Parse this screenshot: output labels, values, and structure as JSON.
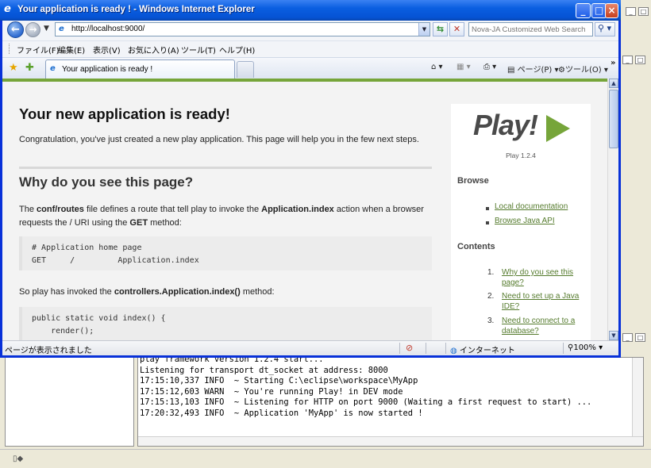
{
  "window": {
    "title": "Your application is ready ! - Windows Internet Explorer",
    "ie_icon": "e"
  },
  "address": {
    "url": "http://localhost:9000/",
    "search_placeholder": "Nova-JA Customized Web Search"
  },
  "menu": [
    "ファイル(F)",
    "編集(E)",
    "表示(V)",
    "お気に入り(A)",
    "ツール(T)",
    "ヘルプ(H)"
  ],
  "tab": {
    "label": "Your application is ready !"
  },
  "toolbar": {
    "page_label": "ページ(P)",
    "tools_label": "ツール(O)",
    "chevron": "»"
  },
  "page": {
    "h1": "Your new application is ready!",
    "intro": "Congratulation, you've just created a new play application. This page will help you in the few next steps.",
    "h2": "Why do you see this page?",
    "p1": {
      "t1": "The ",
      "b1": "conf/routes",
      "t2": " file defines a route that tell play to invoke the ",
      "b2": "Application.index",
      "t3": " action when a browser requests the / URI using the ",
      "b3": "GET",
      "t4": " method:"
    },
    "code1": "# Application home page\nGET     /         Application.index",
    "p2": {
      "t1": "So play has invoked the ",
      "b1": "controllers.Application.index()",
      "t2": " method:"
    },
    "code2": "public static void index() {\n    render();"
  },
  "sidebar": {
    "logo_text": "Play!",
    "version": "Play 1.2.4",
    "browse_heading": "Browse",
    "browse_links": [
      "Local documentation",
      "Browse Java API"
    ],
    "contents_heading": "Contents",
    "contents": [
      {
        "num": "1.",
        "line1": "Why do you see this",
        "line2": "page?"
      },
      {
        "num": "2.",
        "line1": "Need to set up a Java",
        "line2": "IDE?"
      },
      {
        "num": "3.",
        "line1": "Need to connect to a",
        "line2": "database?"
      }
    ]
  },
  "status": {
    "text": "ページが表示されました",
    "zone": "インターネット",
    "zoom": "100%"
  },
  "console": {
    "lines": [
      "play framework version 1.2.4 start...",
      "Listening for transport dt_socket at address: 8000",
      "17:15:10,337 INFO  ~ Starting C:\\eclipse\\workspace\\MyApp",
      "17:15:12,603 WARN  ~ You're running Play! in DEV mode",
      "17:15:13,103 INFO  ~ Listening for HTTP on port 9000 (Waiting a first request to start) ...",
      "17:20:32,493 INFO  ~ Application 'MyApp' is now started !"
    ]
  },
  "colors": {
    "accent_green": "#76a53a",
    "link_green": "#557b2d",
    "titlebar_blue": "#0553d4"
  }
}
